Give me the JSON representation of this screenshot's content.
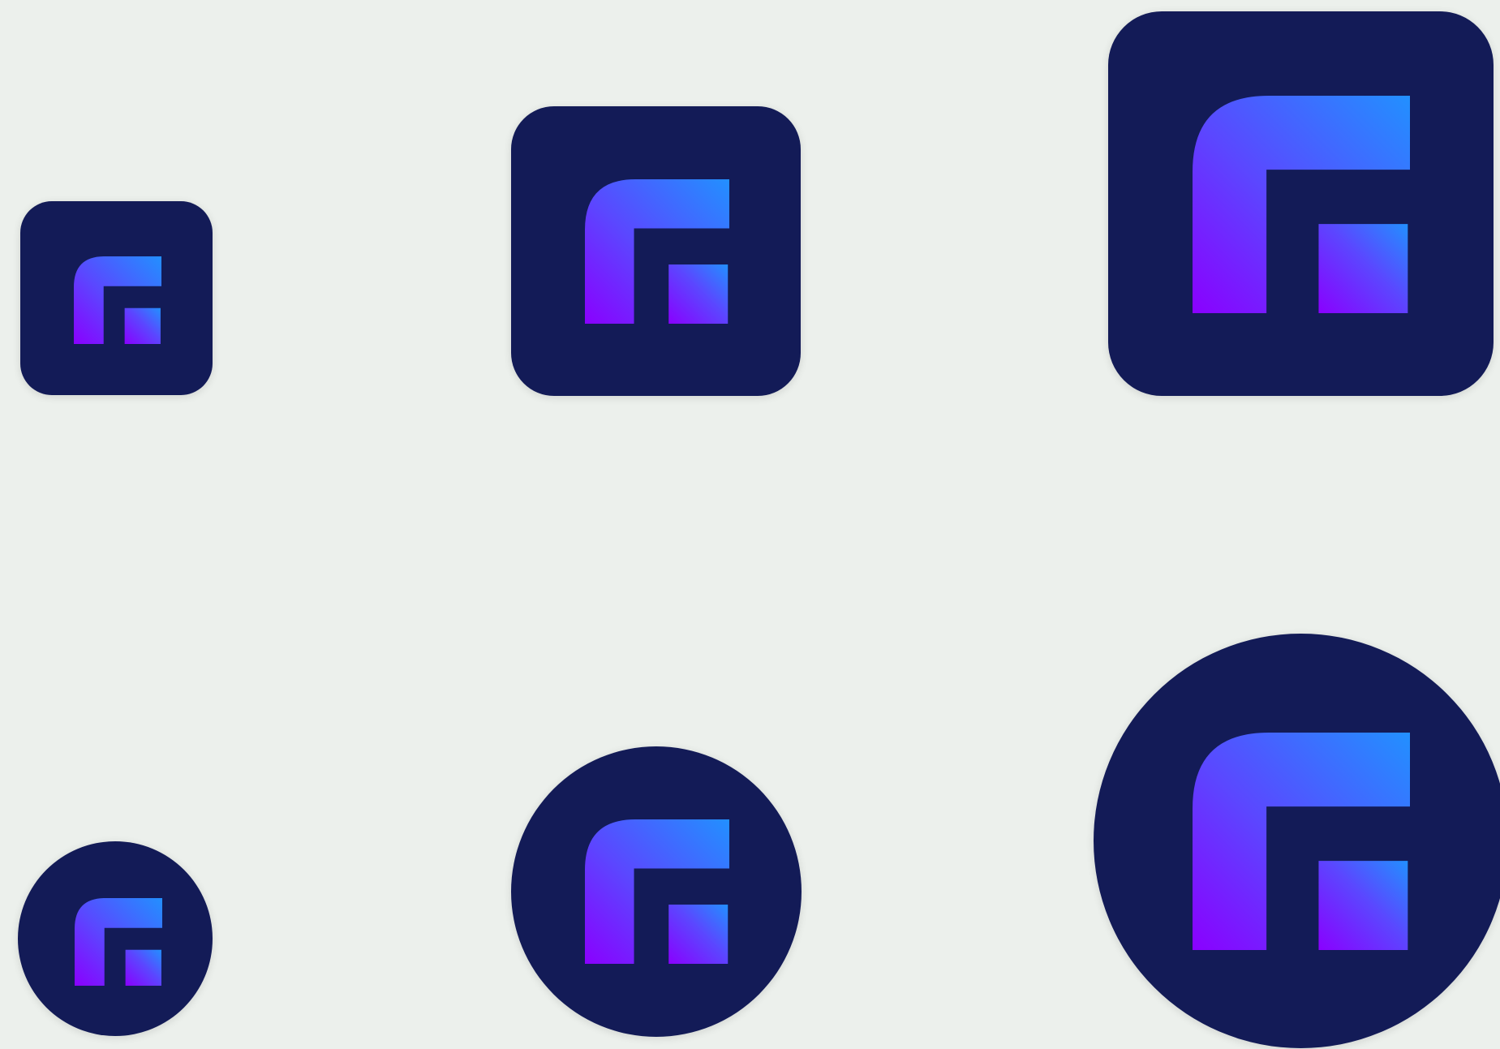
{
  "logo": {
    "icon": "logo-mark-icon",
    "colors": {
      "badge_background": "#131B57",
      "page_background": "#ECF0EC",
      "gradient_blue": "#2290FF",
      "gradient_indigo": "#5B47FF",
      "gradient_violet": "#8A00FF"
    }
  },
  "variants": [
    {
      "shape": "rounded-square",
      "size": "small"
    },
    {
      "shape": "rounded-square",
      "size": "medium"
    },
    {
      "shape": "rounded-square",
      "size": "large"
    },
    {
      "shape": "circle",
      "size": "small"
    },
    {
      "shape": "circle",
      "size": "medium"
    },
    {
      "shape": "circle",
      "size": "large"
    }
  ]
}
